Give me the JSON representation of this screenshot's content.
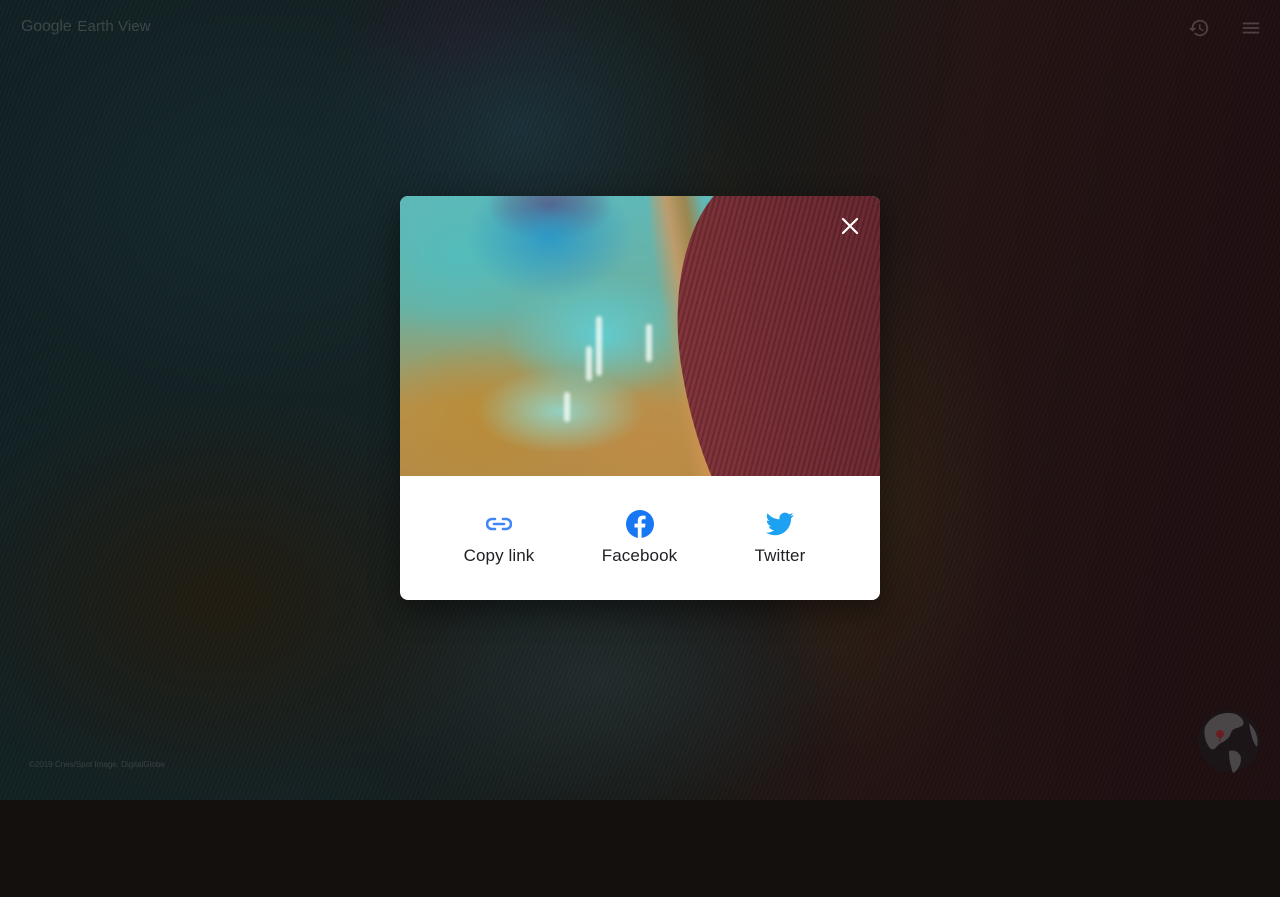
{
  "header": {
    "brand": "Google",
    "product": "Earth View",
    "icons": {
      "history": "history-icon",
      "menu": "menu-icon"
    }
  },
  "footer": {
    "attribution": "©2019 Cnes/Spot Image, DigitalGlobe",
    "globe_icon": "globe-icon"
  },
  "share_dialog": {
    "close_icon": "close-icon",
    "options": [
      {
        "label": "Copy link",
        "icon": "link-icon",
        "color": "#4285f4"
      },
      {
        "label": "Facebook",
        "icon": "facebook-icon",
        "color": "#1877f2"
      },
      {
        "label": "Twitter",
        "icon": "twitter-icon",
        "color": "#1da1f2"
      }
    ]
  }
}
